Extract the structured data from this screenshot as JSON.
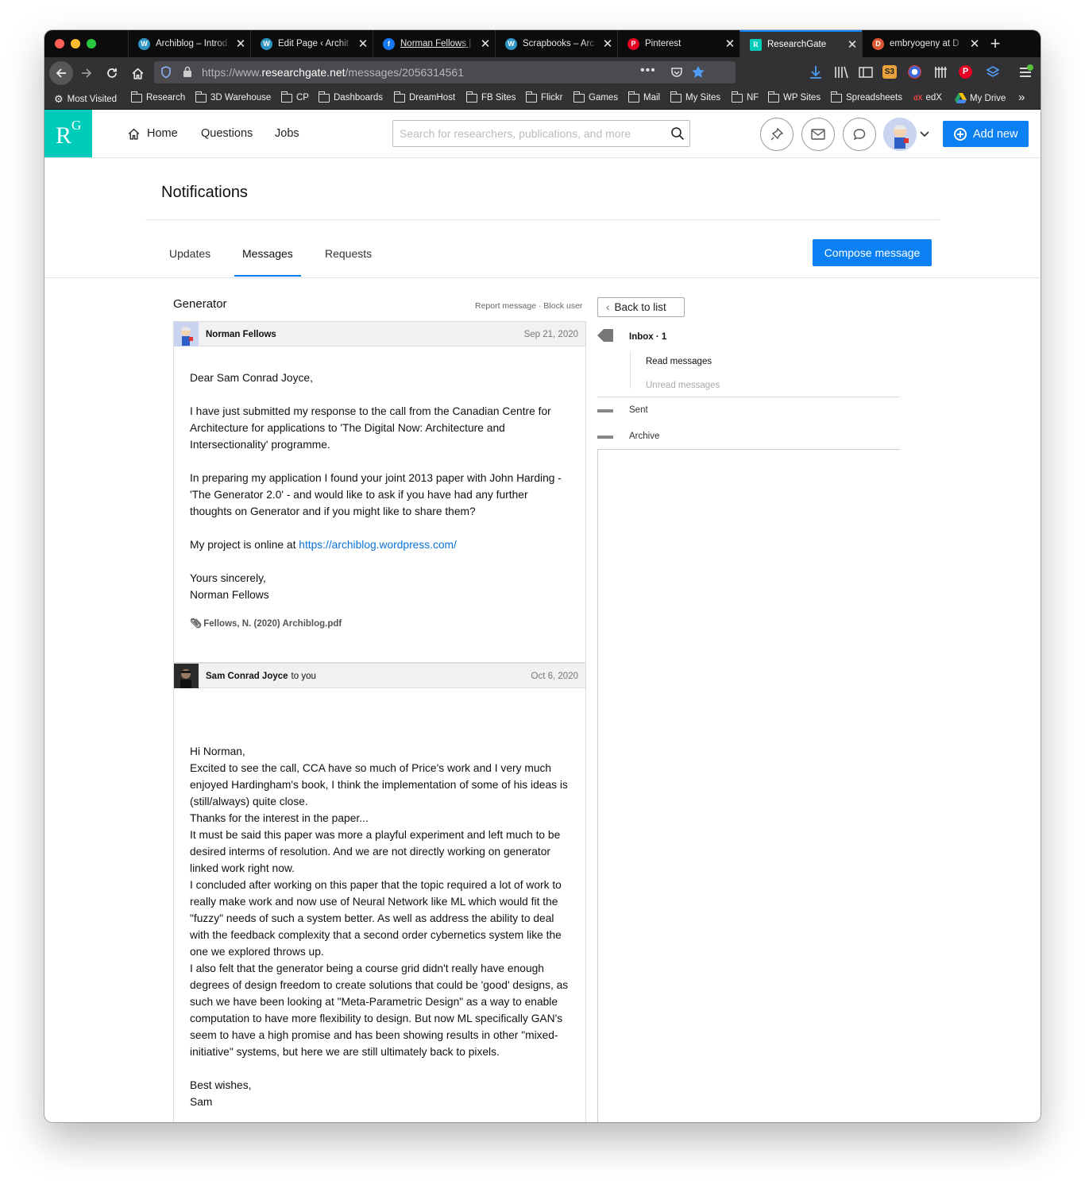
{
  "browser": {
    "tabs": [
      {
        "label": "Archiblog – Introd",
        "icon": "wordpress-icon",
        "color": "#2f93c4"
      },
      {
        "label": "Edit Page ‹ Archit",
        "icon": "wordpress-icon",
        "color": "#2f93c4"
      },
      {
        "label": "Norman Fellows |",
        "icon": "facebook-icon",
        "color": "#1877f2"
      },
      {
        "label": "Scrapbooks – Arc",
        "icon": "wordpress-icon",
        "color": "#2f93c4"
      },
      {
        "label": "Pinterest",
        "icon": "pinterest-icon",
        "color": "#e60023"
      },
      {
        "label": "ResearchGate",
        "icon": "researchgate-icon",
        "color": "#00ccbb"
      },
      {
        "label": "embryogeny at D",
        "icon": "duckduckgo-icon",
        "color": "#de5833"
      }
    ],
    "active_tab": "ResearchGate",
    "url_prefix": "https://www.",
    "url_domain": "researchgate.net",
    "url_path": "/messages/2056314561",
    "bookmarks": [
      "Most Visited",
      "Research",
      "3D Warehouse",
      "CP",
      "Dashboards",
      "DreamHost",
      "FB Sites",
      "Flickr",
      "Games",
      "Mail",
      "My Sites",
      "NF",
      "WP Sites",
      "Spreadsheets",
      "edX",
      "My Drive"
    ]
  },
  "header": {
    "logo_r": "R",
    "logo_g": "G",
    "nav": [
      "Home",
      "Questions",
      "Jobs"
    ],
    "search_placeholder": "Search for researchers, publications, and more",
    "add_new": "Add new",
    "brand_color": "#00ccbb",
    "accent_color": "#0b80f3"
  },
  "notifications": {
    "title": "Notifications",
    "tabs": [
      "Updates",
      "Messages",
      "Requests"
    ],
    "active_tab": "Messages",
    "compose": "Compose message"
  },
  "thread": {
    "subject": "Generator",
    "report": "Report message",
    "block": "Block user",
    "messages": [
      {
        "sender": "Norman Fellows",
        "to": "",
        "date": "Sep 21, 2020",
        "paragraphs": [
          "Dear Sam Conrad Joyce,",
          "I have just submitted my response to the call from the Canadian Centre for Architecture for applications to 'The Digital Now: Architecture and Intersectionality' programme.",
          "In preparing my application I found your joint 2013 paper with John Harding - 'The Generator 2.0' - and would like to ask if you have had any further thoughts on Generator and if you might like to share them?"
        ],
        "project_prefix": "My project is online at ",
        "project_link": "https://archiblog.wordpress.com/",
        "signoff": "Yours sincerely,",
        "signature": "Norman Fellows",
        "attachment": "Fellows, N. (2020) Archiblog.pdf"
      },
      {
        "sender": "Sam Conrad Joyce",
        "to": "to you",
        "date": "Oct 6, 2020",
        "lines": [
          "Hi Norman,",
          "Excited to see the call, CCA have so much of Price's work and I very much enjoyed Hardingham's book, I think the implementation of some of his ideas is (still/always) quite close.",
          "Thanks for the interest in the paper...",
          "It must be said this paper was more a playful experiment and left much to be desired interms of resolution. And we are not directly working on generator linked work right now.",
          "I concluded after working on this paper that the topic required a lot of work to really make work and now use of Neural Network like ML which would fit the \"fuzzy\" needs of such a system better. As well as address the ability to deal with the feedback complexity that a second order cybernetics system like the one we explored throws up.",
          "I also felt that the generator being a course grid didn't really have enough degrees of design freedom to create solutions that could be 'good' designs, as such we have been looking at \"Meta-Parametric Design\" as a way to enable computation to have more flexibility to design. But now ML specifically GAN's seem to have a high promise and has been showing results in other \"mixed-initiative\" systems, but here we are still ultimately back to pixels."
        ],
        "signoff": "Best wishes,",
        "signature": "Sam"
      }
    ]
  },
  "folders": {
    "back": "Back to list",
    "inbox": "Inbox · 1",
    "read": "Read messages",
    "unread": "Unread messages",
    "sent": "Sent",
    "archive": "Archive"
  }
}
